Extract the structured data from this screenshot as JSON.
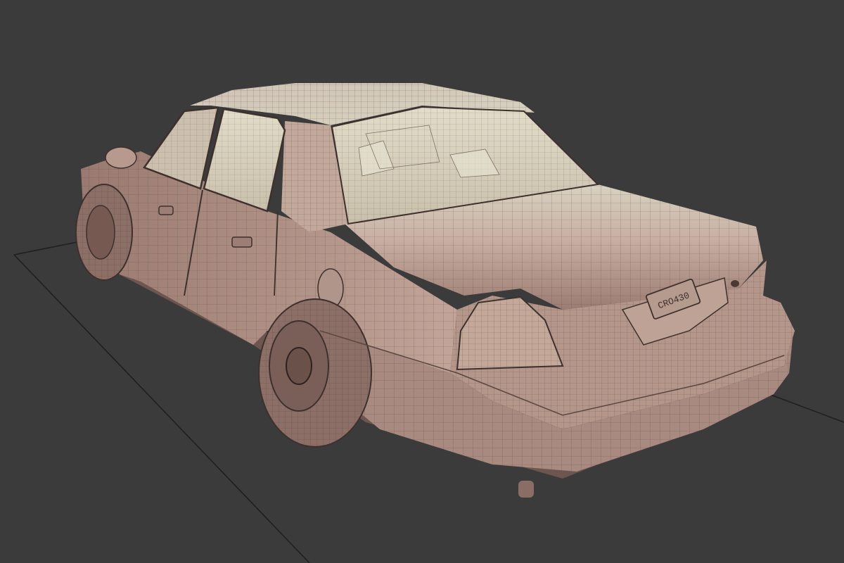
{
  "viewport": {
    "background_color": "#3b3b3b",
    "ground_plane_line_color": "#1f1f1f"
  },
  "model": {
    "subject": "sedan-car-wireframe",
    "surface_color": "#b89a90",
    "surface_highlight_color": "#dcd8c6",
    "wire_color": "#3e302c",
    "license_plate_text": "CRO430"
  }
}
